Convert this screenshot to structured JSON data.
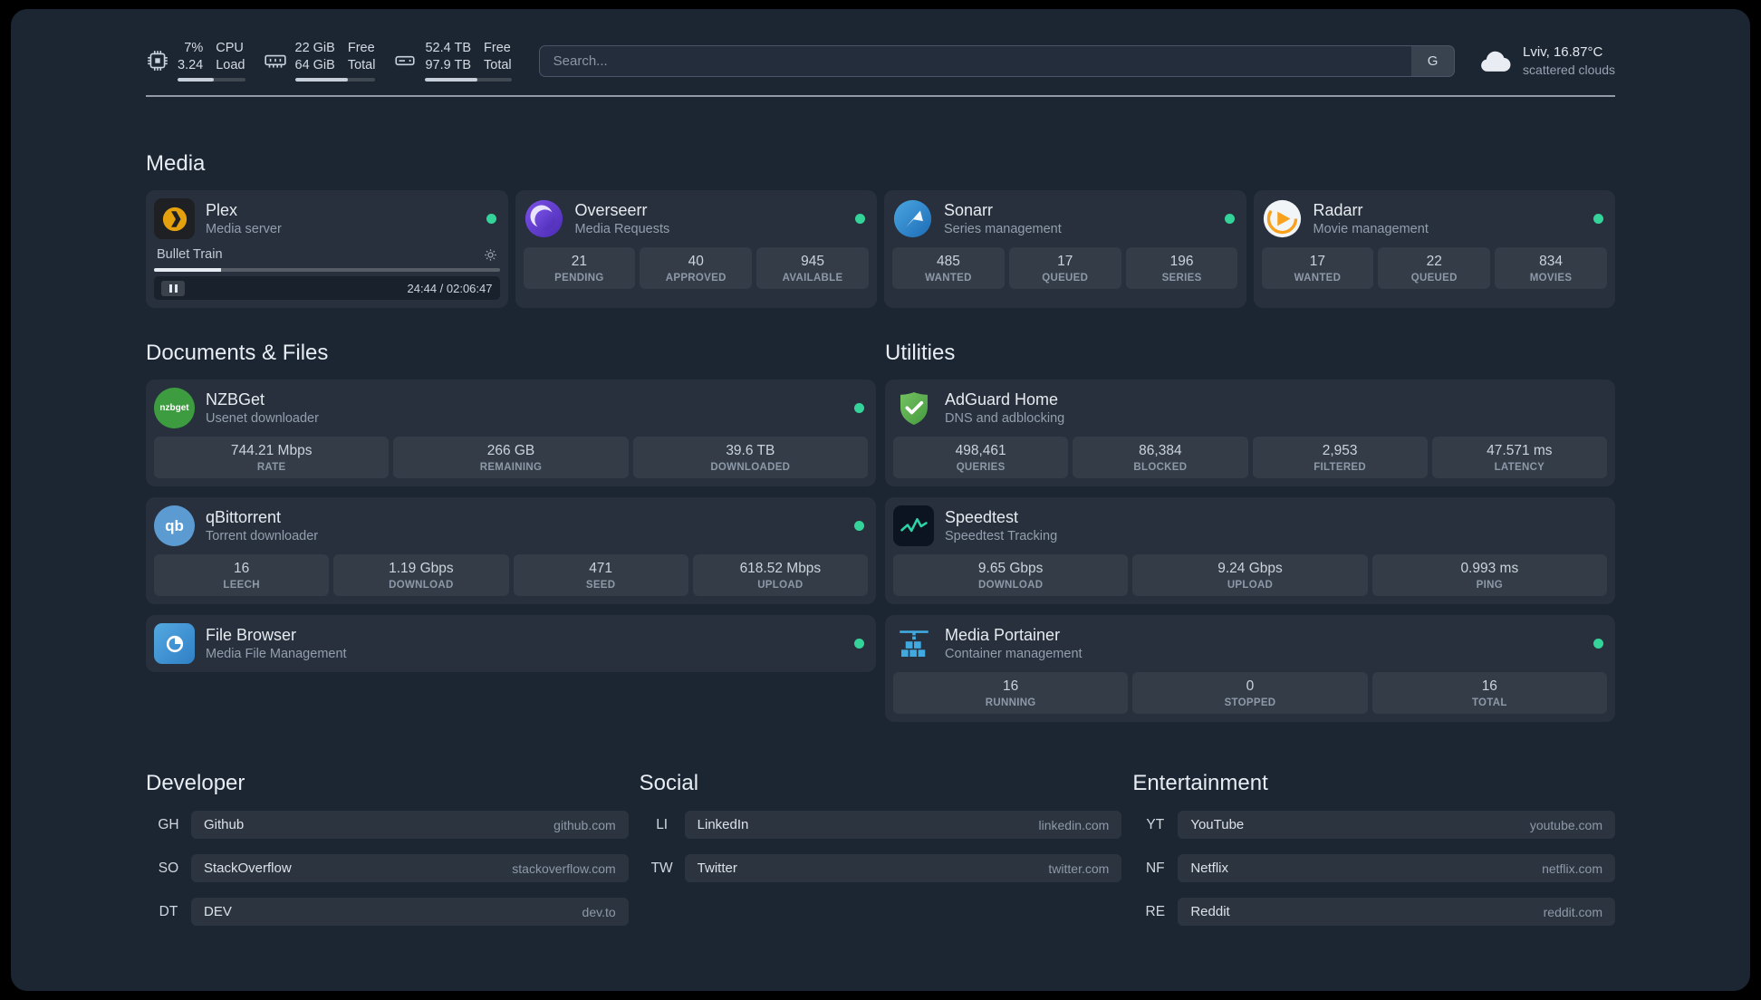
{
  "topbar": {
    "cpu": {
      "value_top": "7%",
      "value_bottom": "3.24",
      "label_top": "CPU",
      "label_bottom": "Load",
      "bar_fill": "54%"
    },
    "memory": {
      "value_top": "22 GiB",
      "value_bottom": "64 GiB",
      "label_top": "Free",
      "label_bottom": "Total",
      "bar_fill": "66%"
    },
    "disk": {
      "value_top": "52.4 TB",
      "value_bottom": "97.9 TB",
      "label_top": "Free",
      "label_bottom": "Total",
      "bar_fill": "60%"
    },
    "search": {
      "placeholder": "Search...",
      "button_label": "G"
    },
    "weather": {
      "location": "Lviv, 16.87°C",
      "condition": "scattered clouds"
    }
  },
  "sections": {
    "media": {
      "title": "Media",
      "cards": {
        "plex": {
          "name": "Plex",
          "subtitle": "Media server",
          "now_playing": {
            "title": "Bullet Train",
            "time": "24:44 / 02:06:47",
            "seek_fill": "19.5%"
          }
        },
        "overseerr": {
          "name": "Overseerr",
          "subtitle": "Media Requests",
          "stats": [
            {
              "value": "21",
              "label": "PENDING"
            },
            {
              "value": "40",
              "label": "APPROVED"
            },
            {
              "value": "945",
              "label": "AVAILABLE"
            }
          ]
        },
        "sonarr": {
          "name": "Sonarr",
          "subtitle": "Series management",
          "stats": [
            {
              "value": "485",
              "label": "WANTED"
            },
            {
              "value": "17",
              "label": "QUEUED"
            },
            {
              "value": "196",
              "label": "SERIES"
            }
          ]
        },
        "radarr": {
          "name": "Radarr",
          "subtitle": "Movie management",
          "stats": [
            {
              "value": "17",
              "label": "WANTED"
            },
            {
              "value": "22",
              "label": "QUEUED"
            },
            {
              "value": "834",
              "label": "MOVIES"
            }
          ]
        }
      }
    },
    "files": {
      "title": "Documents & Files",
      "cards": {
        "nzbget": {
          "name": "NZBGet",
          "subtitle": "Usenet downloader",
          "icon_text": "nzbget",
          "stats": [
            {
              "value": "744.21 Mbps",
              "label": "RATE"
            },
            {
              "value": "266 GB",
              "label": "REMAINING"
            },
            {
              "value": "39.6 TB",
              "label": "DOWNLOADED"
            }
          ]
        },
        "qbittorrent": {
          "name": "qBittorrent",
          "subtitle": "Torrent downloader",
          "icon_text": "qb",
          "stats": [
            {
              "value": "16",
              "label": "LEECH"
            },
            {
              "value": "1.19 Gbps",
              "label": "DOWNLOAD"
            },
            {
              "value": "471",
              "label": "SEED"
            },
            {
              "value": "618.52 Mbps",
              "label": "UPLOAD"
            }
          ]
        },
        "filebrowser": {
          "name": "File Browser",
          "subtitle": "Media File Management"
        }
      }
    },
    "utilities": {
      "title": "Utilities",
      "cards": {
        "adguard": {
          "name": "AdGuard Home",
          "subtitle": "DNS and adblocking",
          "stats": [
            {
              "value": "498,461",
              "label": "QUERIES"
            },
            {
              "value": "86,384",
              "label": "BLOCKED"
            },
            {
              "value": "2,953",
              "label": "FILTERED"
            },
            {
              "value": "47.571 ms",
              "label": "LATENCY"
            }
          ]
        },
        "speedtest": {
          "name": "Speedtest",
          "subtitle": "Speedtest Tracking",
          "stats": [
            {
              "value": "9.65 Gbps",
              "label": "DOWNLOAD"
            },
            {
              "value": "9.24 Gbps",
              "label": "UPLOAD"
            },
            {
              "value": "0.993 ms",
              "label": "PING"
            }
          ]
        },
        "portainer": {
          "name": "Media Portainer",
          "subtitle": "Container management",
          "stats": [
            {
              "value": "16",
              "label": "RUNNING"
            },
            {
              "value": "0",
              "label": "STOPPED"
            },
            {
              "value": "16",
              "label": "TOTAL"
            }
          ]
        }
      }
    },
    "bookmarks": {
      "developer": {
        "title": "Developer",
        "items": [
          {
            "abbr": "GH",
            "name": "Github",
            "domain": "github.com"
          },
          {
            "abbr": "SO",
            "name": "StackOverflow",
            "domain": "stackoverflow.com"
          },
          {
            "abbr": "DT",
            "name": "DEV",
            "domain": "dev.to"
          }
        ]
      },
      "social": {
        "title": "Social",
        "items": [
          {
            "abbr": "LI",
            "name": "LinkedIn",
            "domain": "linkedin.com"
          },
          {
            "abbr": "TW",
            "name": "Twitter",
            "domain": "twitter.com"
          }
        ]
      },
      "entertainment": {
        "title": "Entertainment",
        "items": [
          {
            "abbr": "YT",
            "name": "YouTube",
            "domain": "youtube.com"
          },
          {
            "abbr": "NF",
            "name": "Netflix",
            "domain": "netflix.com"
          },
          {
            "abbr": "RE",
            "name": "Reddit",
            "domain": "reddit.com"
          }
        ]
      }
    }
  },
  "colors": {
    "status_online": "#34d399"
  }
}
